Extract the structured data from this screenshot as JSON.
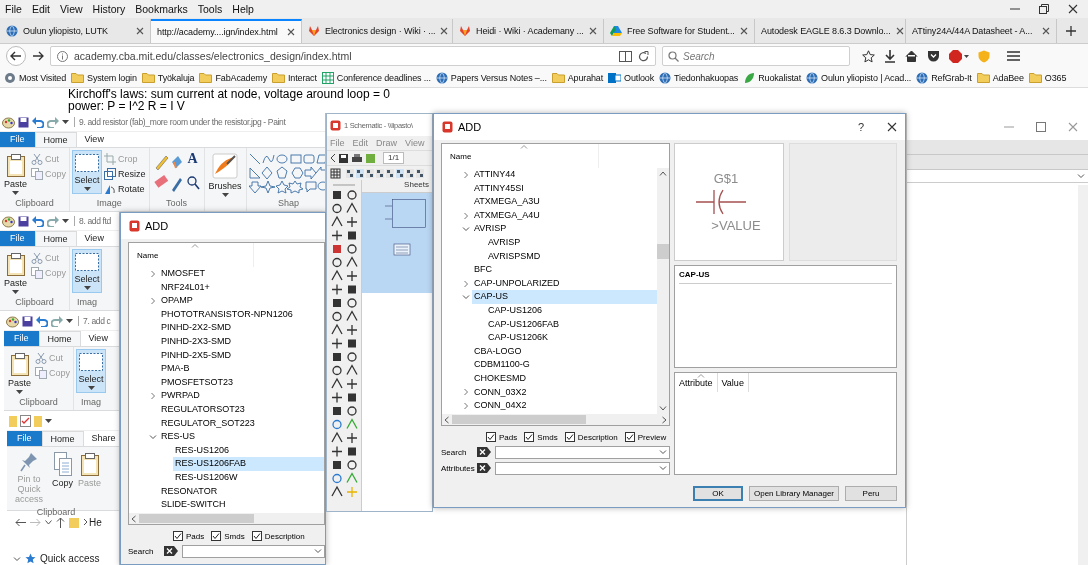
{
  "browser": {
    "menu": [
      "File",
      "Edit",
      "View",
      "History",
      "Bookmarks",
      "Tools",
      "Help"
    ],
    "tabs": [
      {
        "label": "Oulun yliopisto, LUTK",
        "kind": "globe",
        "selected": false
      },
      {
        "label": "http://academy....ign/index.html",
        "kind": "none",
        "selected": true
      },
      {
        "label": "Electronics design · Wiki · ...",
        "kind": "fox",
        "selected": false
      },
      {
        "label": "Heidi · Wiki · Academany ...",
        "kind": "fox",
        "selected": false
      },
      {
        "label": "Free Software for Student...",
        "kind": "drive",
        "selected": false
      },
      {
        "label": "Autodesk EAGLE 8.6.3 Downlo...",
        "kind": "none",
        "selected": false
      },
      {
        "label": "ATtiny24A/44A Datasheet - A...",
        "kind": "none",
        "selected": false
      }
    ],
    "address": {
      "value": "academy.cba.mit.edu/classes/electronics_design/index.html"
    },
    "search": {
      "placeholder": "Search"
    },
    "bookmarks": [
      {
        "label": "Most Visited",
        "kind": "gear"
      },
      {
        "label": "System login",
        "kind": "folder"
      },
      {
        "label": "Työkaluja",
        "kind": "folder"
      },
      {
        "label": "FabAcademy",
        "kind": "folder"
      },
      {
        "label": "Interact",
        "kind": "folder"
      },
      {
        "label": "Conference deadlines ...",
        "kind": "sheet"
      },
      {
        "label": "Papers Versus Notes –...",
        "kind": "globe"
      },
      {
        "label": "Apurahat",
        "kind": "folder"
      },
      {
        "label": "Outlook",
        "kind": "mail"
      },
      {
        "label": "Tiedonhakuopas",
        "kind": "globe"
      },
      {
        "label": "Ruokalistat",
        "kind": "leaf"
      },
      {
        "label": "Oulun yliopisto | Acad...",
        "kind": "globe"
      },
      {
        "label": "RefGrab-It",
        "kind": "globe"
      },
      {
        "label": "AdaBee",
        "kind": "folder"
      },
      {
        "label": "O365",
        "kind": "folder"
      }
    ]
  },
  "page": {
    "lines": [
      "Kirchoff's laws: sum current at node, voltage around loop = 0",
      "power: P = I^2 R = I V"
    ]
  },
  "windows": [
    {
      "kind": "paint",
      "title": "9. add resistor (fab)_more room under the resistor.jpg - Paint",
      "tabs": [
        {
          "label": "File",
          "kind": "file",
          "selected": false
        },
        {
          "label": "Home",
          "kind": "tab",
          "selected": true
        },
        {
          "label": "View",
          "kind": "tab",
          "selected": false
        }
      ],
      "groups": [
        {
          "label": "Clipboard",
          "items": [
            {
              "kind": "paste",
              "label": "Paste",
              "disabled": false,
              "active": false
            },
            {
              "kind": "cut",
              "label": "Cut",
              "disabled": true,
              "active": false
            },
            {
              "kind": "copy",
              "label": "Copy",
              "disabled": true,
              "active": false
            }
          ]
        },
        {
          "label": "Image",
          "items": [
            {
              "kind": "select",
              "label": "Select",
              "disabled": false,
              "active": true
            },
            {
              "kind": "crop",
              "label": "Crop",
              "disabled": true,
              "active": false
            },
            {
              "kind": "resize",
              "label": "Resize",
              "disabled": false,
              "active": false
            },
            {
              "kind": "rotate",
              "label": "Rotate",
              "disabled": false,
              "active": false
            }
          ]
        },
        {
          "label": "Tools",
          "items": [
            {
              "kind": "tools",
              "glyph": "A"
            }
          ]
        },
        {
          "items": [
            {
              "kind": "brushes",
              "label": "Brushes",
              "disabled": false,
              "active": false
            }
          ]
        },
        {
          "label": "Shap",
          "items": [
            {
              "kind": "shapes"
            }
          ]
        }
      ]
    },
    {
      "kind": "paint",
      "title": "8. add ftd",
      "tabs": [
        {
          "label": "File",
          "kind": "file",
          "selected": false
        },
        {
          "label": "Home",
          "kind": "tab",
          "selected": true
        },
        {
          "label": "View",
          "kind": "tab",
          "selected": false
        }
      ],
      "groups": [
        {
          "label": "Clipboard",
          "items": [
            {
              "kind": "paste",
              "label": "Paste",
              "disabled": false,
              "active": false
            },
            {
              "kind": "cut",
              "label": "Cut",
              "disabled": true,
              "active": false
            },
            {
              "kind": "copy",
              "label": "Copy",
              "disabled": true,
              "active": false
            }
          ]
        },
        {
          "label": "Imag",
          "items": [
            {
              "kind": "select",
              "label": "Select",
              "disabled": false,
              "active": true
            }
          ]
        }
      ]
    },
    {
      "kind": "paint",
      "title": "7. add c",
      "tabs": [
        {
          "label": "File",
          "kind": "file",
          "selected": false
        },
        {
          "label": "Home",
          "kind": "tab",
          "selected": true
        },
        {
          "label": "View",
          "kind": "tab",
          "selected": false
        }
      ],
      "groups": [
        {
          "label": "Clipboard",
          "items": [
            {
              "kind": "paste",
              "label": "Paste",
              "disabled": false,
              "active": false
            },
            {
              "kind": "cut",
              "label": "Cut",
              "disabled": true,
              "active": false
            },
            {
              "kind": "copy",
              "label": "Copy",
              "disabled": true,
              "active": false
            }
          ]
        },
        {
          "label": "Imag",
          "items": [
            {
              "kind": "select",
              "label": "Select",
              "disabled": false,
              "active": true
            }
          ]
        }
      ]
    },
    {
      "kind": "explorer",
      "tabs": [
        {
          "label": "File",
          "kind": "file",
          "selected": false
        },
        {
          "label": "Home",
          "kind": "tab",
          "selected": true
        },
        {
          "label": "Share",
          "kind": "tab",
          "selected": false
        }
      ],
      "groups": [
        {
          "label": "Clipboard",
          "items": [
            {
              "kind": "pin",
              "label": "Pin to Quick access",
              "disabled": true,
              "active": false
            },
            {
              "kind": "duplicate",
              "label": "Copy",
              "disabled": false,
              "active": false
            },
            {
              "kind": "paste",
              "label": "Paste",
              "disabled": true,
              "active": false
            }
          ]
        }
      ],
      "address": "He",
      "nav": [
        {
          "label": "Quick access",
          "expanded": true
        }
      ]
    }
  ],
  "eagle": {
    "title": "1 Schematic - \\\\lipasto\\",
    "menu": [
      "File",
      "Edit",
      "Draw",
      "View"
    ],
    "page_field": "1/1",
    "sheets_header": "Sheets"
  },
  "add_dialogs": [
    {
      "title": "ADD",
      "help": "?",
      "tree": {
        "header": "Name",
        "items": [
          {
            "label": "ATTINY44",
            "expanded": false,
            "selected": false
          },
          {
            "label": "ATTINY45SI",
            "selected": false
          },
          {
            "label": "ATXMEGA_A3U",
            "selected": false
          },
          {
            "label": "ATXMEGA_A4U",
            "expanded": false,
            "selected": false
          },
          {
            "label": "AVRISP",
            "expanded": true,
            "selected": false,
            "children": [
              {
                "label": "AVRISP",
                "selected": false
              },
              {
                "label": "AVRISPSMD",
                "selected": false
              }
            ]
          },
          {
            "label": "BFC",
            "selected": false
          },
          {
            "label": "CAP-UNPOLARIZED",
            "expanded": false,
            "selected": false
          },
          {
            "label": "CAP-US",
            "expanded": true,
            "selected": true,
            "children": [
              {
                "label": "CAP-US1206",
                "selected": false
              },
              {
                "label": "CAP-US1206FAB",
                "selected": false
              },
              {
                "label": "CAP-US1206K",
                "selected": false
              }
            ]
          },
          {
            "label": "CBA-LOGO",
            "selected": false
          },
          {
            "label": "CDBM1100-G",
            "selected": false
          },
          {
            "label": "CHOKESMD",
            "selected": false
          },
          {
            "label": "CONN_03X2",
            "expanded": false,
            "selected": false
          },
          {
            "label": "CONN_04X2",
            "expanded": false,
            "selected": false
          }
        ]
      },
      "options": [
        {
          "label": "Pads",
          "checked": true
        },
        {
          "label": "Smds",
          "checked": true
        },
        {
          "label": "Description",
          "checked": true
        },
        {
          "label": "Preview",
          "checked": true
        }
      ],
      "fields": [
        {
          "label": "Search"
        },
        {
          "label": "Attributes"
        }
      ],
      "preview": {
        "name": "G$1",
        "value": ">VALUE"
      },
      "description": "CAP-US",
      "attributes": {
        "columns": [
          "Attribute",
          "Value"
        ]
      },
      "buttons": [
        {
          "label": "OK",
          "default": true
        },
        {
          "label": "Open Library Manager",
          "default": false
        },
        {
          "label": "Peru",
          "default": false
        }
      ]
    },
    {
      "title": "ADD",
      "tree": {
        "header": "Name",
        "items": [
          {
            "label": "NMOSFET",
            "expanded": false,
            "selected": false
          },
          {
            "label": "NRF24L01+",
            "selected": false
          },
          {
            "label": "OPAMP",
            "expanded": false,
            "selected": false
          },
          {
            "label": "PHOTOTRANSISTOR-NPN1206",
            "selected": false
          },
          {
            "label": "PINHD-2X2-SMD",
            "selected": false
          },
          {
            "label": "PINHD-2X3-SMD",
            "selected": false
          },
          {
            "label": "PINHD-2X5-SMD",
            "selected": false
          },
          {
            "label": "PMA-B",
            "selected": false
          },
          {
            "label": "PMOSFETSOT23",
            "selected": false
          },
          {
            "label": "PWRPAD",
            "expanded": false,
            "selected": false
          },
          {
            "label": "REGULATORSOT23",
            "selected": false
          },
          {
            "label": "REGULATOR_SOT223",
            "selected": false
          },
          {
            "label": "RES-US",
            "expanded": true,
            "selected": false,
            "children": [
              {
                "label": "RES-US1206",
                "selected": false
              },
              {
                "label": "RES-US1206FAB",
                "selected": true
              },
              {
                "label": "RES-US1206W",
                "selected": false
              }
            ]
          },
          {
            "label": "RESONATOR",
            "selected": false
          },
          {
            "label": "SLIDE-SWITCH",
            "selected": false
          }
        ]
      },
      "options": [
        {
          "label": "Pads",
          "checked": true
        },
        {
          "label": "Smds",
          "checked": true
        },
        {
          "label": "Description",
          "checked": true
        }
      ],
      "fields": [
        {
          "label": "Search"
        }
      ]
    }
  ]
}
